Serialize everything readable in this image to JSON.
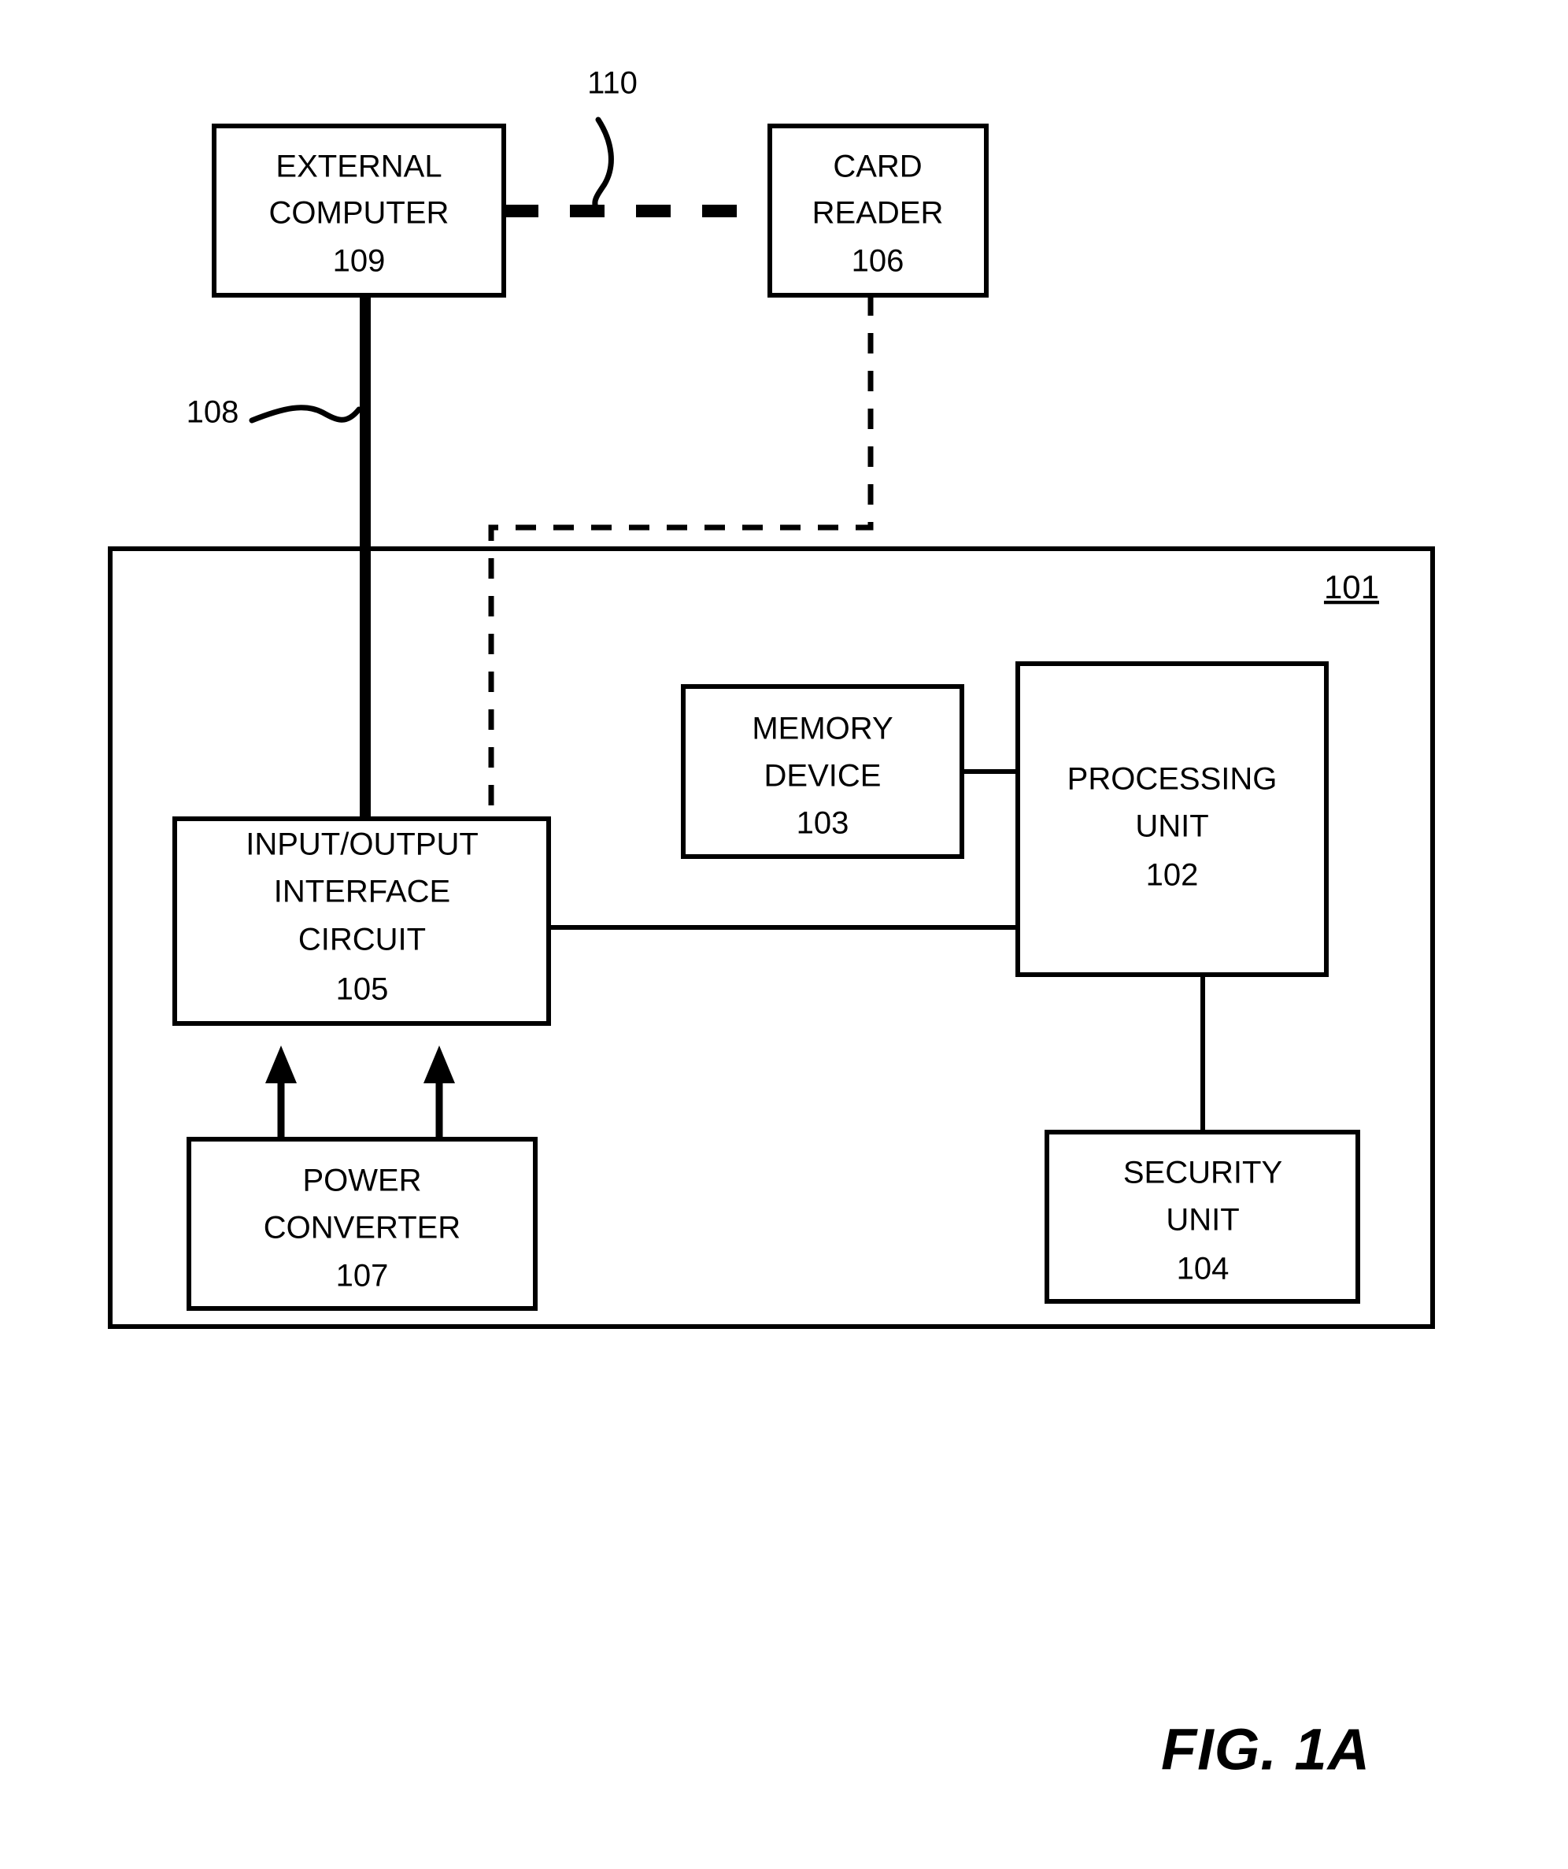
{
  "figure": {
    "caption": "FIG. 1A",
    "enclosure_ref": "101"
  },
  "blocks": {
    "external_computer": {
      "line1": "EXTERNAL",
      "line2": "COMPUTER",
      "ref": "109"
    },
    "card_reader": {
      "line1": "CARD",
      "line2": "READER",
      "ref": "106"
    },
    "memory_device": {
      "line1": "MEMORY",
      "line2": "DEVICE",
      "ref": "103"
    },
    "processing_unit": {
      "line1": "PROCESSING",
      "line2": "UNIT",
      "ref": "102"
    },
    "io_interface": {
      "line1": "INPUT/OUTPUT",
      "line2": "INTERFACE",
      "line3": "CIRCUIT",
      "ref": "105"
    },
    "power_converter": {
      "line1": "POWER",
      "line2": "CONVERTER",
      "ref": "107"
    },
    "security_unit": {
      "line1": "SECURITY",
      "line2": "UNIT",
      "ref": "104"
    }
  },
  "connector_labels": {
    "wireless_link": "110",
    "wired_link": "108"
  },
  "colors": {
    "ink": "#000000",
    "paper": "#ffffff"
  }
}
